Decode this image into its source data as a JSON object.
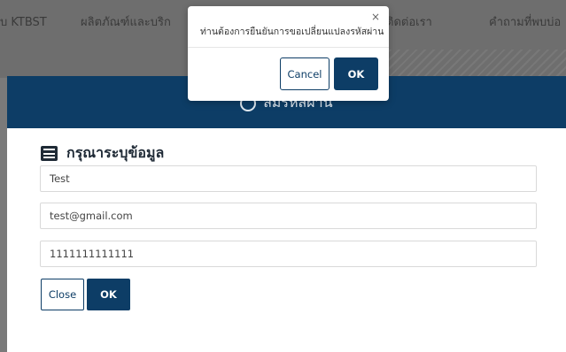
{
  "nav": {
    "items": [
      "ับ KTBST",
      "ผลิตภัณฑ์และบริก",
      "ติดต่อเรา",
      "คำถามที่พบบ่อ"
    ]
  },
  "form_modal": {
    "header_title": "ลืมรหัสผ่าน",
    "section_title": "กรุณาระบุข้อมูล",
    "fields": [
      {
        "value": "Test"
      },
      {
        "value": "test@gmail.com"
      },
      {
        "value": "1111111111111"
      }
    ],
    "close_label": "Close",
    "ok_label": "OK"
  },
  "confirm_dialog": {
    "message": "ท่านต้องการยืนยันการขอเปลี่ยนแปลงรหัสผ่าน",
    "close_symbol": "×",
    "cancel_label": "Cancel",
    "ok_label": "OK"
  },
  "colors": {
    "primary": "#0d3d66",
    "overlay": "#7a7a7a"
  }
}
